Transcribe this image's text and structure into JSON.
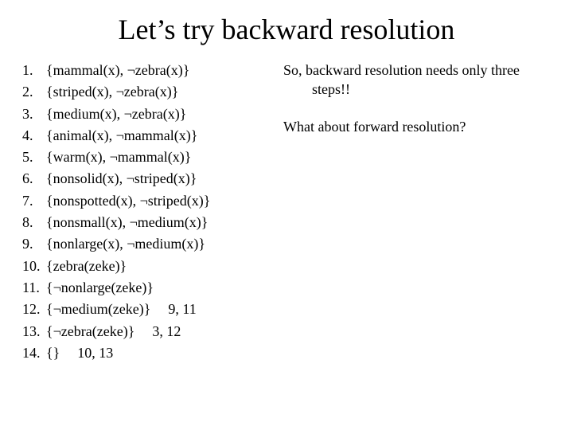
{
  "title": "Let’s try backward resolution",
  "clauses": [
    {
      "n": "1.",
      "text": "{mammal(x), ¬zebra(x)}",
      "just": ""
    },
    {
      "n": "2.",
      "text": "{striped(x), ¬zebra(x)}",
      "just": ""
    },
    {
      "n": "3.",
      "text": "{medium(x), ¬zebra(x)}",
      "just": ""
    },
    {
      "n": "4.",
      "text": "{animal(x), ¬mammal(x)}",
      "just": ""
    },
    {
      "n": "5.",
      "text": "{warm(x), ¬mammal(x)}",
      "just": ""
    },
    {
      "n": "6.",
      "text": "{nonsolid(x), ¬striped(x)}",
      "just": ""
    },
    {
      "n": "7.",
      "text": "{nonspotted(x), ¬striped(x)}",
      "just": ""
    },
    {
      "n": "8.",
      "text": "{nonsmall(x), ¬medium(x)}",
      "just": ""
    },
    {
      "n": "9.",
      "text": "{nonlarge(x), ¬medium(x)}",
      "just": ""
    },
    {
      "n": "10.",
      "text": "{zebra(zeke)}",
      "just": ""
    },
    {
      "n": "11.",
      "text": "{¬nonlarge(zeke)}",
      "just": ""
    },
    {
      "n": "12.",
      "text": "{¬medium(zeke)}",
      "just": "9, 11"
    },
    {
      "n": "13.",
      "text": "{¬zebra(zeke)}",
      "just": "3, 12"
    },
    {
      "n": "14.",
      "text": "{}",
      "just": "10, 13"
    }
  ],
  "right_para1_line1": "So, backward resolution needs only three",
  "right_para1_line2": "steps!!",
  "right_para2": "What about forward resolution?"
}
